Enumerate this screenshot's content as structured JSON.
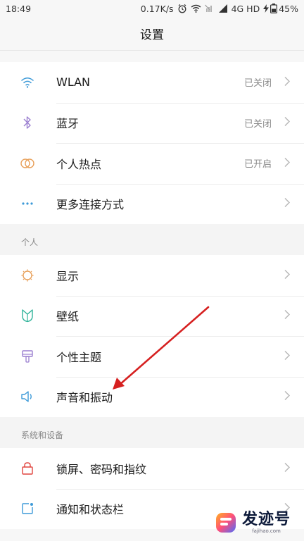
{
  "status": {
    "time": "18:49",
    "speed": "0.17K/s",
    "network": "4G HD",
    "battery": "45%"
  },
  "title": "设置",
  "sections": {
    "network": [
      {
        "label": "WLAN",
        "value": "已关闭",
        "icon": "wifi-icon"
      },
      {
        "label": "蓝牙",
        "value": "已关闭",
        "icon": "bluetooth-icon"
      },
      {
        "label": "个人热点",
        "value": "已开启",
        "icon": "hotspot-icon"
      },
      {
        "label": "更多连接方式",
        "value": "",
        "icon": "more-dots-icon"
      }
    ],
    "personal_header": "个人",
    "personal": [
      {
        "label": "显示",
        "icon": "brightness-icon"
      },
      {
        "label": "壁纸",
        "icon": "wallpaper-icon"
      },
      {
        "label": "个性主题",
        "icon": "theme-brush-icon"
      },
      {
        "label": "声音和振动",
        "icon": "speaker-icon"
      }
    ],
    "system_header": "系统和设备",
    "system": [
      {
        "label": "锁屏、密码和指纹",
        "icon": "lock-icon"
      },
      {
        "label": "通知和状态栏",
        "icon": "notification-icon"
      }
    ]
  },
  "watermark": {
    "brand": "发迹号",
    "domain": "fajihao.com"
  },
  "colors": {
    "accent_blue": "#3d9ad8",
    "accent_purple": "#9b7fd0",
    "accent_orange": "#e8a05a",
    "accent_teal": "#2fb39a",
    "accent_red": "#e0443e",
    "arrow_red": "#d62020"
  }
}
